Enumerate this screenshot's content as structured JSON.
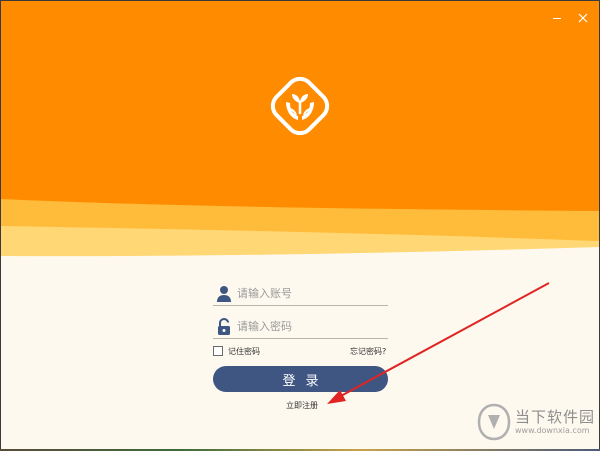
{
  "window": {
    "minimize_icon": "minimize-icon",
    "close_icon": "close-icon"
  },
  "colors": {
    "header_orange": "#ff8c00",
    "wave_mid": "#ffbb3a",
    "wave_light": "#ffd775",
    "body_bg": "#fdf9ee",
    "button_bg": "#3f5683",
    "icon_navy": "#3f5683",
    "arrow_red": "#e02424"
  },
  "logo": {
    "icon": "sprout-hands-logo"
  },
  "login": {
    "username_placeholder": "请输入账号",
    "password_placeholder": "请输入密码",
    "user_icon": "user-icon",
    "lock_icon": "lock-icon",
    "remember_label": "记住密码",
    "forgot_label": "忘记密码?",
    "submit_label": "登录",
    "register_label": "立即注册"
  },
  "watermark": {
    "name": "当下软件园",
    "url": "www.downxia.com"
  }
}
